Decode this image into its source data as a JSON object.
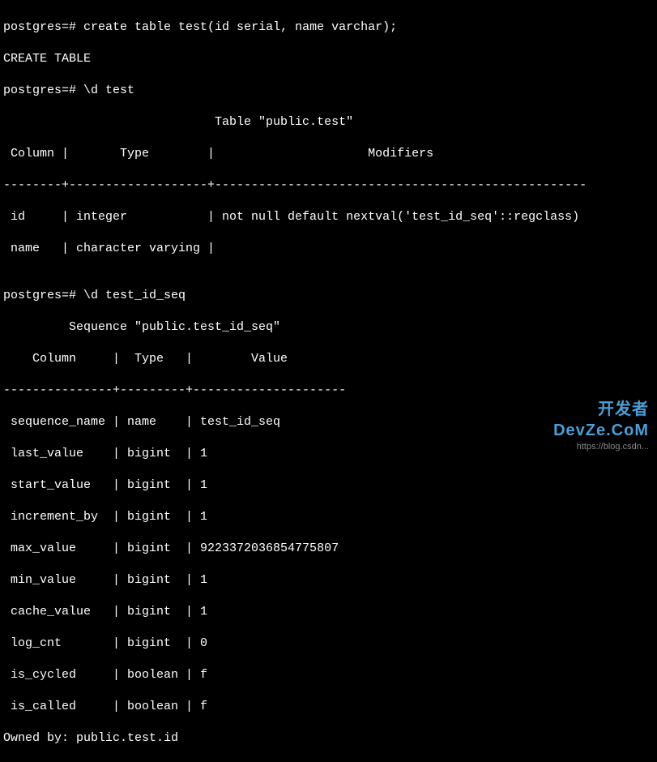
{
  "terminal": {
    "prompt1": "postgres=# ",
    "cmd1": "create table test(id serial, name varchar);",
    "result1": "CREATE TABLE",
    "prompt2": "postgres=# ",
    "cmd2": "\\d test",
    "table1_title": "                             Table \"public.test\"",
    "table1_header": " Column |       Type        |                     Modifiers",
    "table1_divider": "--------+-------------------+---------------------------------------------------",
    "table1_row1": " id     | integer           | not null default nextval('test_id_seq'::regclass)",
    "table1_row2": " name   | character varying |",
    "blank": "",
    "prompt3": "postgres=# ",
    "cmd3": "\\d test_id_seq",
    "table2_title": "         Sequence \"public.test_id_seq\"",
    "table2_header": "    Column     |  Type   |        Value",
    "table2_divider": "---------------+---------+---------------------",
    "seq_rows": [
      " sequence_name | name    | test_id_seq",
      " last_value    | bigint  | 1",
      " start_value   | bigint  | 1",
      " increment_by  | bigint  | 1",
      " max_value     | bigint  | 9223372036854775807",
      " min_value     | bigint  | 1",
      " cache_value   | bigint  | 1",
      " log_cnt       | bigint  | 0",
      " is_cycled     | boolean | f",
      " is_called     | boolean | f"
    ],
    "owned_by": "Owned by: public.test.id"
  },
  "watermark": {
    "brand": "开发者",
    "brand2": "DevZe.CoM",
    "url": "https://blog.csdn..."
  }
}
